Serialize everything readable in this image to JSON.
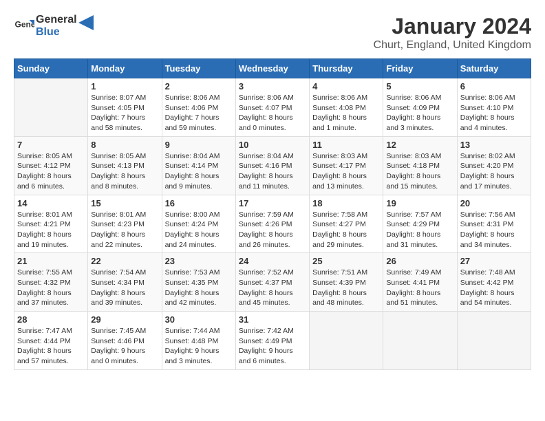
{
  "header": {
    "logo_general": "General",
    "logo_blue": "Blue",
    "month_title": "January 2024",
    "location": "Churt, England, United Kingdom"
  },
  "weekdays": [
    "Sunday",
    "Monday",
    "Tuesday",
    "Wednesday",
    "Thursday",
    "Friday",
    "Saturday"
  ],
  "weeks": [
    [
      {
        "day": "",
        "info": ""
      },
      {
        "day": "1",
        "info": "Sunrise: 8:07 AM\nSunset: 4:05 PM\nDaylight: 7 hours\nand 58 minutes."
      },
      {
        "day": "2",
        "info": "Sunrise: 8:06 AM\nSunset: 4:06 PM\nDaylight: 7 hours\nand 59 minutes."
      },
      {
        "day": "3",
        "info": "Sunrise: 8:06 AM\nSunset: 4:07 PM\nDaylight: 8 hours\nand 0 minutes."
      },
      {
        "day": "4",
        "info": "Sunrise: 8:06 AM\nSunset: 4:08 PM\nDaylight: 8 hours\nand 1 minute."
      },
      {
        "day": "5",
        "info": "Sunrise: 8:06 AM\nSunset: 4:09 PM\nDaylight: 8 hours\nand 3 minutes."
      },
      {
        "day": "6",
        "info": "Sunrise: 8:06 AM\nSunset: 4:10 PM\nDaylight: 8 hours\nand 4 minutes."
      }
    ],
    [
      {
        "day": "7",
        "info": "Sunrise: 8:05 AM\nSunset: 4:12 PM\nDaylight: 8 hours\nand 6 minutes."
      },
      {
        "day": "8",
        "info": "Sunrise: 8:05 AM\nSunset: 4:13 PM\nDaylight: 8 hours\nand 8 minutes."
      },
      {
        "day": "9",
        "info": "Sunrise: 8:04 AM\nSunset: 4:14 PM\nDaylight: 8 hours\nand 9 minutes."
      },
      {
        "day": "10",
        "info": "Sunrise: 8:04 AM\nSunset: 4:16 PM\nDaylight: 8 hours\nand 11 minutes."
      },
      {
        "day": "11",
        "info": "Sunrise: 8:03 AM\nSunset: 4:17 PM\nDaylight: 8 hours\nand 13 minutes."
      },
      {
        "day": "12",
        "info": "Sunrise: 8:03 AM\nSunset: 4:18 PM\nDaylight: 8 hours\nand 15 minutes."
      },
      {
        "day": "13",
        "info": "Sunrise: 8:02 AM\nSunset: 4:20 PM\nDaylight: 8 hours\nand 17 minutes."
      }
    ],
    [
      {
        "day": "14",
        "info": "Sunrise: 8:01 AM\nSunset: 4:21 PM\nDaylight: 8 hours\nand 19 minutes."
      },
      {
        "day": "15",
        "info": "Sunrise: 8:01 AM\nSunset: 4:23 PM\nDaylight: 8 hours\nand 22 minutes."
      },
      {
        "day": "16",
        "info": "Sunrise: 8:00 AM\nSunset: 4:24 PM\nDaylight: 8 hours\nand 24 minutes."
      },
      {
        "day": "17",
        "info": "Sunrise: 7:59 AM\nSunset: 4:26 PM\nDaylight: 8 hours\nand 26 minutes."
      },
      {
        "day": "18",
        "info": "Sunrise: 7:58 AM\nSunset: 4:27 PM\nDaylight: 8 hours\nand 29 minutes."
      },
      {
        "day": "19",
        "info": "Sunrise: 7:57 AM\nSunset: 4:29 PM\nDaylight: 8 hours\nand 31 minutes."
      },
      {
        "day": "20",
        "info": "Sunrise: 7:56 AM\nSunset: 4:31 PM\nDaylight: 8 hours\nand 34 minutes."
      }
    ],
    [
      {
        "day": "21",
        "info": "Sunrise: 7:55 AM\nSunset: 4:32 PM\nDaylight: 8 hours\nand 37 minutes."
      },
      {
        "day": "22",
        "info": "Sunrise: 7:54 AM\nSunset: 4:34 PM\nDaylight: 8 hours\nand 39 minutes."
      },
      {
        "day": "23",
        "info": "Sunrise: 7:53 AM\nSunset: 4:35 PM\nDaylight: 8 hours\nand 42 minutes."
      },
      {
        "day": "24",
        "info": "Sunrise: 7:52 AM\nSunset: 4:37 PM\nDaylight: 8 hours\nand 45 minutes."
      },
      {
        "day": "25",
        "info": "Sunrise: 7:51 AM\nSunset: 4:39 PM\nDaylight: 8 hours\nand 48 minutes."
      },
      {
        "day": "26",
        "info": "Sunrise: 7:49 AM\nSunset: 4:41 PM\nDaylight: 8 hours\nand 51 minutes."
      },
      {
        "day": "27",
        "info": "Sunrise: 7:48 AM\nSunset: 4:42 PM\nDaylight: 8 hours\nand 54 minutes."
      }
    ],
    [
      {
        "day": "28",
        "info": "Sunrise: 7:47 AM\nSunset: 4:44 PM\nDaylight: 8 hours\nand 57 minutes."
      },
      {
        "day": "29",
        "info": "Sunrise: 7:45 AM\nSunset: 4:46 PM\nDaylight: 9 hours\nand 0 minutes."
      },
      {
        "day": "30",
        "info": "Sunrise: 7:44 AM\nSunset: 4:48 PM\nDaylight: 9 hours\nand 3 minutes."
      },
      {
        "day": "31",
        "info": "Sunrise: 7:42 AM\nSunset: 4:49 PM\nDaylight: 9 hours\nand 6 minutes."
      },
      {
        "day": "",
        "info": ""
      },
      {
        "day": "",
        "info": ""
      },
      {
        "day": "",
        "info": ""
      }
    ]
  ]
}
